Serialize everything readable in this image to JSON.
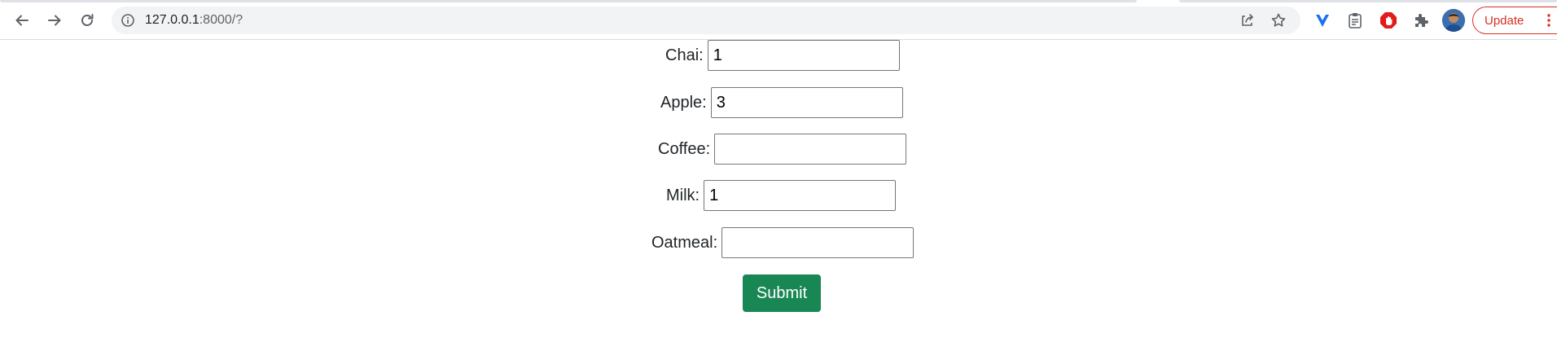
{
  "browser": {
    "url_host": "127.0.0.1",
    "url_path": ":8000/?",
    "update_label": "Update",
    "colors": {
      "update_accent": "#d93025",
      "omnibox_bg": "#f1f3f4"
    },
    "icons": [
      "back-icon",
      "forward-icon",
      "reload-icon",
      "info-icon",
      "share-icon",
      "star-icon",
      "extension-v-icon",
      "clipboard-icon",
      "adblock-icon",
      "puzzle-icon",
      "avatar",
      "kebab-menu-icon"
    ]
  },
  "form": {
    "fields": [
      {
        "label": "Chai:",
        "value": "1"
      },
      {
        "label": "Apple:",
        "value": "3"
      },
      {
        "label": "Coffee:",
        "value": ""
      },
      {
        "label": "Milk:",
        "value": "1"
      },
      {
        "label": "Oatmeal:",
        "value": ""
      }
    ],
    "submit_label": "Submit",
    "colors": {
      "submit_bg": "#198754"
    }
  }
}
